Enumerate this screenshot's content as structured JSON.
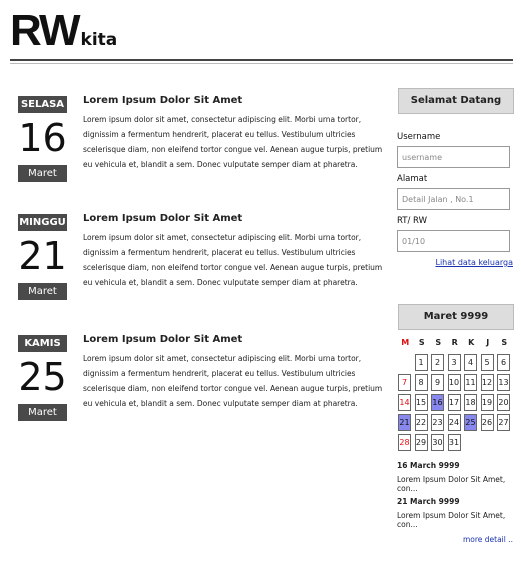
{
  "header": {
    "logo_main": "RW",
    "logo_sub": "kita"
  },
  "posts": [
    {
      "day": "SELASA",
      "date": "16",
      "month": "Maret",
      "title": "Lorem Ipsum Dolor Sit Amet",
      "body": "Lorem ipsum dolor sit amet, consectetur adipiscing elit. Morbi urna tortor, dignissim a fermentum hendrerit, placerat eu tellus. Vestibulum ultricies scelerisque diam, non eleifend tortor congue vel. Aenean augue turpis, pretium eu vehicula et, blandit a sem. Donec vulputate semper diam at pharetra."
    },
    {
      "day": "MINGGU",
      "date": "21",
      "month": "Maret",
      "title": "Lorem Ipsum Dolor Sit Amet",
      "body": "Lorem ipsum dolor sit amet, consectetur adipiscing elit. Morbi urna tortor, dignissim a fermentum hendrerit, placerat eu tellus. Vestibulum ultricies scelerisque diam, non eleifend tortor congue vel. Aenean augue turpis, pretium eu vehicula et, blandit a sem. Donec vulputate semper diam at pharetra."
    },
    {
      "day": "KAMIS",
      "date": "25",
      "month": "Maret",
      "title": "Lorem Ipsum Dolor Sit Amet",
      "body": "Lorem ipsum dolor sit amet, consectetur adipiscing elit. Morbi urna tortor, dignissim a fermentum hendrerit, placerat eu tellus. Vestibulum ultricies scelerisque diam, non eleifend tortor congue vel. Aenean augue turpis, pretium eu vehicula et, blandit a sem. Donec vulputate semper diam at pharetra."
    }
  ],
  "welcome": {
    "title": "Selamat Datang",
    "username_label": "Username",
    "username_placeholder": "username",
    "alamat_label": "Alamat",
    "alamat_placeholder": "Detail Jalan , No.1",
    "rtrw_label": "RT/ RW",
    "rtrw_placeholder": "01/10",
    "link": "Lihat data keluarga"
  },
  "calendar": {
    "title": "Maret 9999",
    "weekdays": [
      "M",
      "S",
      "S",
      "R",
      "K",
      "J",
      "S"
    ],
    "weeks": [
      [
        "",
        "1",
        "2",
        "3",
        "4",
        "5",
        "6"
      ],
      [
        "7",
        "8",
        "9",
        "10",
        "11",
        "12",
        "13"
      ],
      [
        "14",
        "15",
        "16",
        "17",
        "18",
        "19",
        "20"
      ],
      [
        "21",
        "22",
        "23",
        "24",
        "25",
        "26",
        "27"
      ],
      [
        "28",
        "29",
        "30",
        "31",
        "",
        "",
        ""
      ]
    ],
    "highlighted": [
      "16",
      "21",
      "25"
    ],
    "sunday_color": "#dd1111",
    "highlight_color": "#8888ee"
  },
  "events": [
    {
      "date": "16 March 9999",
      "text": "Lorem Ipsum Dolor Sit Amet, con..."
    },
    {
      "date": "21 March 9999",
      "text": "Lorem Ipsum Dolor Sit Amet, con..."
    }
  ],
  "more_link": "more detail .."
}
